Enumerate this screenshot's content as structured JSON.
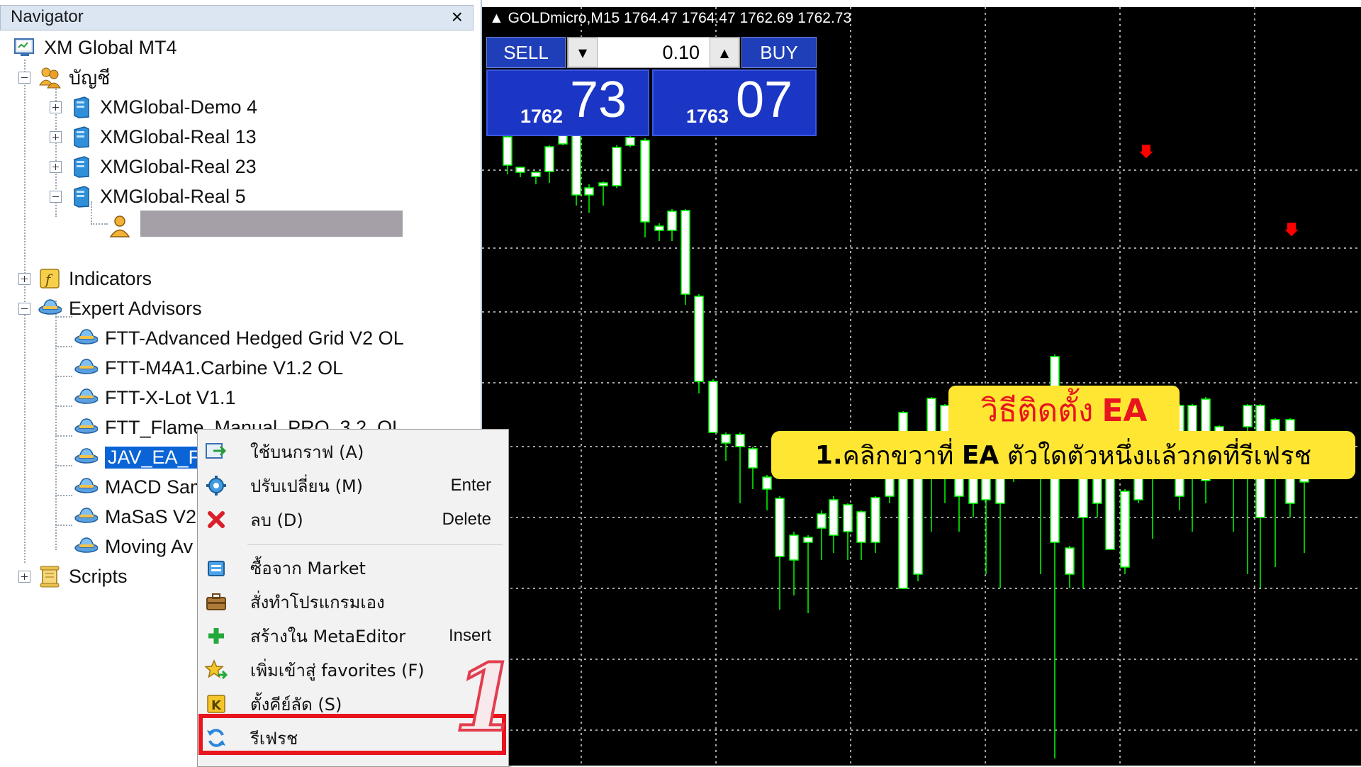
{
  "navigator": {
    "title": "Navigator",
    "close_glyph": "×",
    "root": "XM Global MT4",
    "accounts_label": "บัญชี",
    "accounts": [
      {
        "label": "XMGlobal-Demo 4",
        "expanded": false
      },
      {
        "label": "XMGlobal-Real 13",
        "expanded": false
      },
      {
        "label": "XMGlobal-Real 23",
        "expanded": false
      },
      {
        "label": "XMGlobal-Real 5",
        "expanded": true
      }
    ],
    "indicators_label": "Indicators",
    "expert_advisors_label": "Expert Advisors",
    "experts": [
      {
        "label": "FTT-Advanced Hedged Grid V2 OL"
      },
      {
        "label": "FTT-M4A1.Carbine V1.2 OL"
      },
      {
        "label": "FTT-X-Lot V1.1"
      },
      {
        "label": "FTT_Flame_Manual_PRO_3.2_OL"
      },
      {
        "label": "JAV_EA_FTT_V2 OL",
        "selected": true
      },
      {
        "label": "MACD Sam"
      },
      {
        "label": "MaSaS V2."
      },
      {
        "label": "Moving Av"
      }
    ],
    "scripts_label": "Scripts"
  },
  "chart": {
    "header": "GOLDmicro,M15  1764.47 1764.47 1762.69 1762.73",
    "trade": {
      "sell_label": "SELL",
      "buy_label": "BUY",
      "lot": "0.10",
      "sell_small": "1762",
      "sell_big": "73",
      "buy_small": "1763",
      "buy_big": "07"
    },
    "colors": {
      "background": "#000000",
      "up_candle": "#000000",
      "down_candle": "#ffffff",
      "wick": "#00ff00",
      "grid": "#ffffff",
      "arrow": "#ff0000"
    }
  },
  "context_menu": {
    "items": [
      {
        "icon": "attach-chart-icon",
        "label": "ใช้บนกราฟ (A)",
        "key": ""
      },
      {
        "icon": "modify-gear-icon",
        "label": "ปรับเปลี่ยน (M)",
        "key": "Enter"
      },
      {
        "icon": "delete-x-icon",
        "label": "ลบ (D)",
        "key": "Delete"
      },
      {
        "icon": "market-bag-icon",
        "label": "ซื้อจาก Market",
        "key": ""
      },
      {
        "icon": "briefcase-icon",
        "label": "สั่งทำโปรแกรมเอง",
        "key": ""
      },
      {
        "icon": "plus-icon",
        "label": "สร้างใน MetaEditor",
        "key": "Insert"
      },
      {
        "icon": "star-icon",
        "label": "เพิ่มเข้าสู่ favorites (F)",
        "key": ""
      },
      {
        "icon": "hotkey-k-icon",
        "label": "ตั้งคีย์ลัด (S)",
        "key": ""
      },
      {
        "icon": "refresh-icon",
        "label": "รีเฟรช",
        "key": ""
      }
    ]
  },
  "annotation": {
    "step_number": "1",
    "title_prefix": "วิธีติดตั้ง",
    "title_ea": "EA",
    "step_bold": "1.",
    "step_text1": "คลิกขวาที่ ",
    "step_ea": "EA",
    "step_text2": " ตัวใดตัวหนึ่งแล้วกดที่รีเฟรช"
  }
}
